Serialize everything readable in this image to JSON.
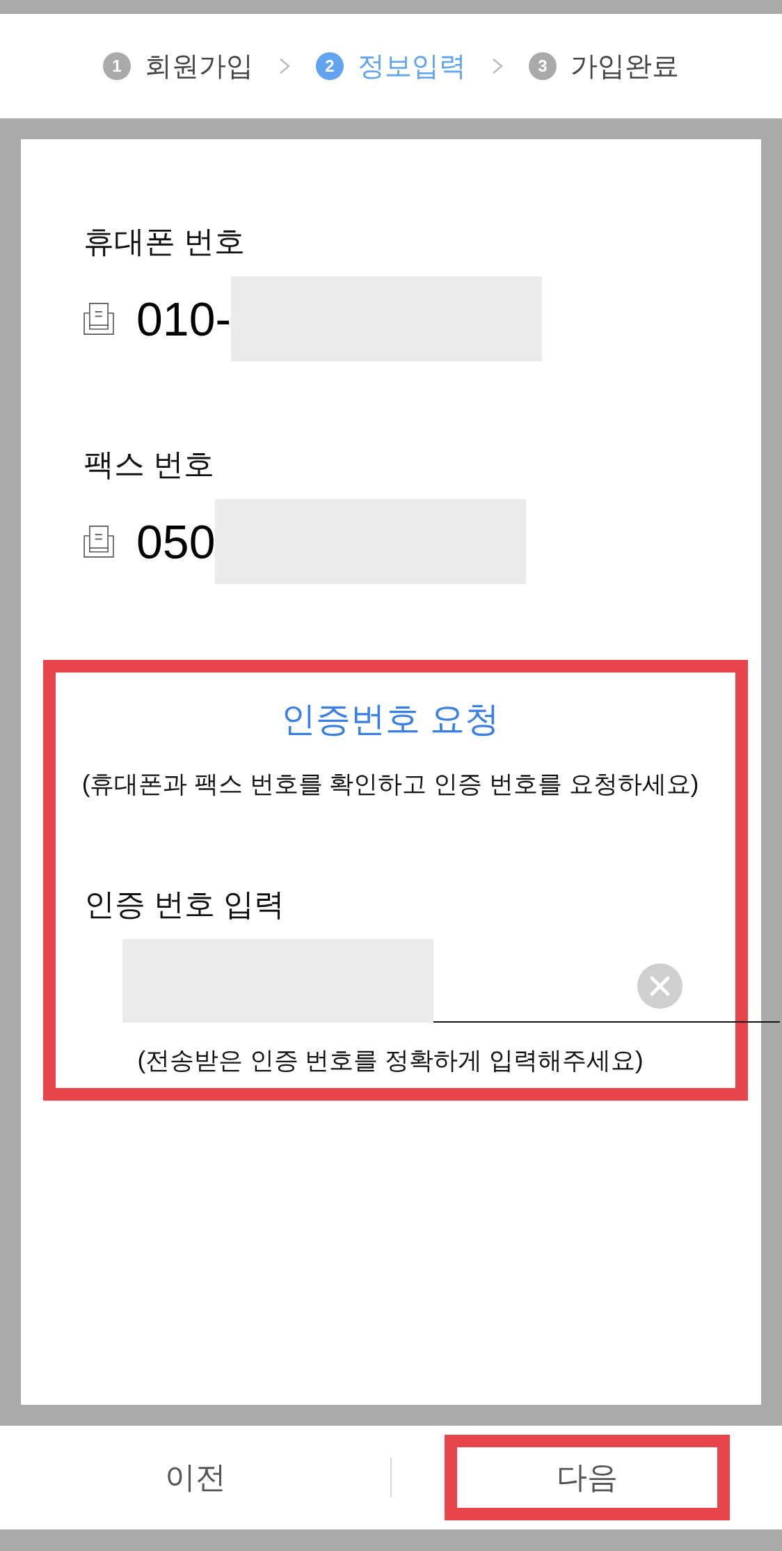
{
  "stepper": {
    "steps": [
      {
        "number": "1",
        "label": "회원가입",
        "selected": false
      },
      {
        "number": "2",
        "label": "정보입력",
        "selected": true
      },
      {
        "number": "3",
        "label": "가입완료",
        "selected": false
      }
    ]
  },
  "fields": [
    {
      "label": "휴대폰 번호",
      "value": "010-",
      "redacted": true
    },
    {
      "label": "팩스 번호",
      "value": "050",
      "redacted": true
    }
  ],
  "verification": {
    "highlighted": true,
    "request_button": "인증번호 요청",
    "note": "(휴대폰과 팩스 번호를 확인하고 인증 번호를 요청하세요)",
    "input_label": "인증 번호 입력",
    "code_redacted": true,
    "hint": "(전송받은 인증 번호를 정확하게 입력해주세요)"
  },
  "buttons": [
    {
      "label": "이전",
      "highlighted": false
    },
    {
      "label": "다음",
      "highlighted": true
    }
  ]
}
